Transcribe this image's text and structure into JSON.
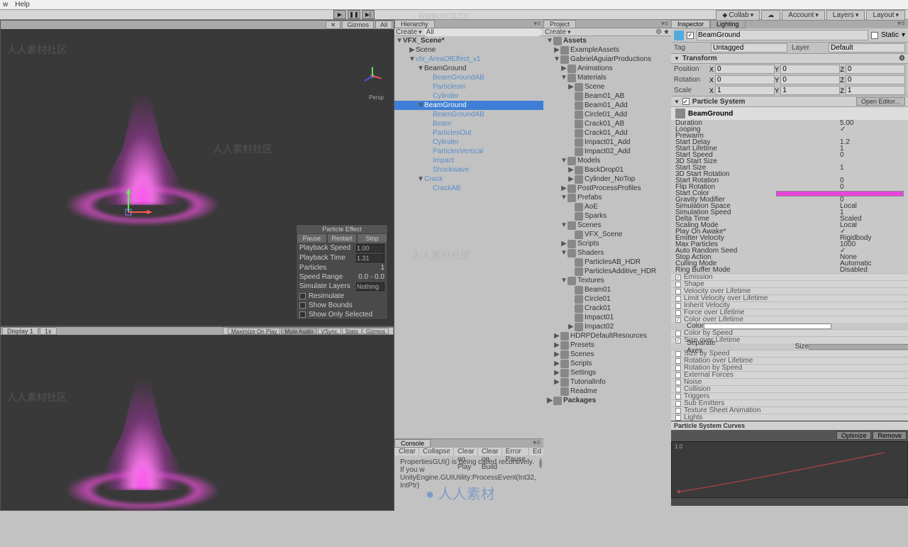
{
  "menu": {
    "items": [
      "w",
      "Help"
    ]
  },
  "toolbar": {
    "play": "▶",
    "pause": "❚❚",
    "step": "▶|",
    "collab": "Collab",
    "cloud": "☁",
    "account": "Account",
    "layers": "Layers",
    "layout": "Layout"
  },
  "scene": {
    "tabs": {
      "x": "✕",
      "gizmos": "Gizmos",
      "all": "All"
    },
    "persp": "Persp"
  },
  "particleEffect": {
    "title": "Particle Effect",
    "pause": "Pause",
    "restart": "Restart",
    "stop": "Stop",
    "playbackSpeed": {
      "label": "Playback Speed",
      "value": "1.00"
    },
    "playbackTime": {
      "label": "Playback Time",
      "value": "1.31"
    },
    "particles": {
      "label": "Particles",
      "value": "1"
    },
    "speedRange": {
      "label": "Speed Range",
      "value": "0.0 - 0.0"
    },
    "simulateLayers": {
      "label": "Simulate Layers",
      "value": "Nothing"
    },
    "resimulate": "Resimulate",
    "showBounds": "Show Bounds",
    "showOnlySelected": "Show Only Selected"
  },
  "game": {
    "display": "Display 1",
    "scale": "1x",
    "maxOnPlay": "Maximize On Play",
    "mute": "Mute Audio",
    "vsync": "VSync",
    "stats": "Stats",
    "gizmos": "Gizmos"
  },
  "hierarchy": {
    "tab": "Hierarchy",
    "create": "Create",
    "search": "All",
    "root": "VFX_Scene*",
    "items": [
      {
        "d": 1,
        "t": "Scene",
        "a": "▶"
      },
      {
        "d": 1,
        "t": "vfx_AreaOfEffect_v1",
        "a": "▼",
        "blue": true
      },
      {
        "d": 2,
        "t": "BeamGround",
        "a": "▼"
      },
      {
        "d": 3,
        "t": "BeamGroundAB",
        "blue": true
      },
      {
        "d": 3,
        "t": "ParticlesIn",
        "blue": true
      },
      {
        "d": 3,
        "t": "Cylinder",
        "blue": true
      },
      {
        "d": 2,
        "t": "BeamGround",
        "a": "▼",
        "sel": true
      },
      {
        "d": 3,
        "t": "BeamGroundAB",
        "blue": true
      },
      {
        "d": 3,
        "t": "Beam",
        "blue": true
      },
      {
        "d": 3,
        "t": "ParticlesOut",
        "blue": true
      },
      {
        "d": 3,
        "t": "Cylinder",
        "blue": true
      },
      {
        "d": 3,
        "t": "ParticlesVertical",
        "blue": true
      },
      {
        "d": 3,
        "t": "Impact",
        "blue": true
      },
      {
        "d": 3,
        "t": "Shockwave",
        "blue": true
      },
      {
        "d": 2,
        "t": "Crack",
        "a": "▼",
        "blue": true
      },
      {
        "d": 3,
        "t": "CrackAB",
        "blue": true
      }
    ]
  },
  "project": {
    "tab": "Project",
    "create": "Create",
    "items": [
      {
        "d": 0,
        "t": "Assets",
        "a": "▼",
        "bold": true
      },
      {
        "d": 1,
        "t": "ExampleAssets",
        "a": "▶"
      },
      {
        "d": 1,
        "t": "GabrielAguiarProductions",
        "a": "▼"
      },
      {
        "d": 2,
        "t": "Animations",
        "a": "▶"
      },
      {
        "d": 2,
        "t": "Materials",
        "a": "▼"
      },
      {
        "d": 3,
        "t": "Scene",
        "a": "▶"
      },
      {
        "d": 3,
        "t": "Beam01_AB"
      },
      {
        "d": 3,
        "t": "Beam01_Add"
      },
      {
        "d": 3,
        "t": "Circle01_Add"
      },
      {
        "d": 3,
        "t": "Crack01_AB"
      },
      {
        "d": 3,
        "t": "Crack01_Add"
      },
      {
        "d": 3,
        "t": "Impact01_Add"
      },
      {
        "d": 3,
        "t": "Impact02_Add"
      },
      {
        "d": 2,
        "t": "Models",
        "a": "▼"
      },
      {
        "d": 3,
        "t": "BackDrop01",
        "a": "▶"
      },
      {
        "d": 3,
        "t": "Cylinder_NoTop",
        "a": "▶"
      },
      {
        "d": 2,
        "t": "PostProcessProfiles",
        "a": "▶"
      },
      {
        "d": 2,
        "t": "Prefabs",
        "a": "▼"
      },
      {
        "d": 3,
        "t": "AoE"
      },
      {
        "d": 3,
        "t": "Sparks"
      },
      {
        "d": 2,
        "t": "Scenes",
        "a": "▼"
      },
      {
        "d": 3,
        "t": "VFX_Scene"
      },
      {
        "d": 2,
        "t": "Scripts",
        "a": "▶"
      },
      {
        "d": 2,
        "t": "Shaders",
        "a": "▼"
      },
      {
        "d": 3,
        "t": "ParticlesAB_HDR"
      },
      {
        "d": 3,
        "t": "ParticlesAdditive_HDR"
      },
      {
        "d": 2,
        "t": "Textures",
        "a": "▼"
      },
      {
        "d": 3,
        "t": "Beam01"
      },
      {
        "d": 3,
        "t": "Circle01"
      },
      {
        "d": 3,
        "t": "Crack01"
      },
      {
        "d": 3,
        "t": "Impact01"
      },
      {
        "d": 3,
        "t": "Impact02",
        "a": "▶"
      },
      {
        "d": 1,
        "t": "HDRPDefaultResources",
        "a": "▶"
      },
      {
        "d": 1,
        "t": "Presets",
        "a": "▶"
      },
      {
        "d": 1,
        "t": "Scenes",
        "a": "▶"
      },
      {
        "d": 1,
        "t": "Scripts",
        "a": "▶"
      },
      {
        "d": 1,
        "t": "Settings",
        "a": "▶"
      },
      {
        "d": 1,
        "t": "TutorialInfo",
        "a": "▶"
      },
      {
        "d": 1,
        "t": "Readme"
      },
      {
        "d": 0,
        "t": "Packages",
        "a": "▶",
        "bold": true
      }
    ]
  },
  "console": {
    "tab": "Console",
    "clear": "Clear",
    "collapse": "Collapse",
    "clearOnPlay": "Clear on Play",
    "clearOnBuild": "Clear on Build",
    "errorPause": "Error Pause",
    "editor": "Ed",
    "msg1": "PropertiesGUI() is being called recursively. If you w",
    "msg2": "UnityEngine.GUIUtility:ProcessEvent(Int32, IntPtr)"
  },
  "inspector": {
    "tab": "Inspector",
    "tab2": "Lighting",
    "name": "BeamGround",
    "static": "Static",
    "tag": {
      "label": "Tag",
      "value": "Untagged"
    },
    "layer": {
      "label": "Layer",
      "value": "Default"
    },
    "transform": {
      "title": "Transform",
      "position": {
        "label": "Position",
        "x": "0",
        "y": "0",
        "z": "0"
      },
      "rotation": {
        "label": "Rotation",
        "x": "0",
        "y": "0",
        "z": "0"
      },
      "scale": {
        "label": "Scale",
        "x": "1",
        "y": "1",
        "z": "1"
      }
    },
    "ps": {
      "title": "Particle System",
      "openEditor": "Open Editor...",
      "subtitle": "BeamGround",
      "props": [
        {
          "k": "Duration",
          "v": "5.00"
        },
        {
          "k": "Looping",
          "v": "✓"
        },
        {
          "k": "Prewarm",
          "v": ""
        },
        {
          "k": "Start Delay",
          "v": "1.2"
        },
        {
          "k": "Start Lifetime",
          "v": "1"
        },
        {
          "k": "Start Speed",
          "v": "0"
        },
        {
          "k": "3D Start Size",
          "v": ""
        },
        {
          "k": "Start Size",
          "v": "1"
        },
        {
          "k": "3D Start Rotation",
          "v": ""
        },
        {
          "k": "Start Rotation",
          "v": "0"
        },
        {
          "k": "Flip Rotation",
          "v": "0"
        },
        {
          "k": "Start Color",
          "v": "",
          "color": true
        },
        {
          "k": "Gravity Modifier",
          "v": "0"
        },
        {
          "k": "Simulation Space",
          "v": "Local"
        },
        {
          "k": "Simulation Speed",
          "v": "1"
        },
        {
          "k": "Delta Time",
          "v": "Scaled"
        },
        {
          "k": "Scaling Mode",
          "v": "Local"
        },
        {
          "k": "Play On Awake*",
          "v": "✓"
        },
        {
          "k": "Emitter Velocity",
          "v": "Rigidbody"
        },
        {
          "k": "Max Particles",
          "v": "1000"
        },
        {
          "k": "Auto Random Seed",
          "v": "✓"
        },
        {
          "k": "Stop Action",
          "v": "None"
        },
        {
          "k": "Culling Mode",
          "v": "Automatic"
        },
        {
          "k": "Ring Buffer Mode",
          "v": "Disabled"
        }
      ],
      "modules": [
        {
          "n": "Emission",
          "on": true
        },
        {
          "n": "Shape",
          "on": false
        },
        {
          "n": "Velocity over Lifetime",
          "on": false
        },
        {
          "n": "Limit Velocity over Lifetime",
          "on": false
        },
        {
          "n": "Inherit Velocity",
          "on": false
        },
        {
          "n": "Force over Lifetime",
          "on": false
        },
        {
          "n": "Color over Lifetime",
          "on": true,
          "sw": "white"
        },
        {
          "n": "Color by Speed",
          "on": false
        },
        {
          "n": "Size over Lifetime",
          "on": true,
          "sw": "bar"
        },
        {
          "n": "Size by Speed",
          "on": false
        },
        {
          "n": "Rotation over Lifetime",
          "on": false
        },
        {
          "n": "Rotation by Speed",
          "on": false
        },
        {
          "n": "External Forces",
          "on": false
        },
        {
          "n": "Noise",
          "on": false
        },
        {
          "n": "Collision",
          "on": false
        },
        {
          "n": "Triggers",
          "on": false
        },
        {
          "n": "Sub Emitters",
          "on": false
        },
        {
          "n": "Texture Sheet Animation",
          "on": false
        },
        {
          "n": "Lights",
          "on": false
        }
      ],
      "colorLabel": "Color",
      "separateAxes": "Separate Axes",
      "sizeLabel": "Size"
    },
    "curves": {
      "title": "Particle System Curves",
      "optimize": "Optimize",
      "remove": "Remove",
      "ylabel": "1.0"
    }
  }
}
